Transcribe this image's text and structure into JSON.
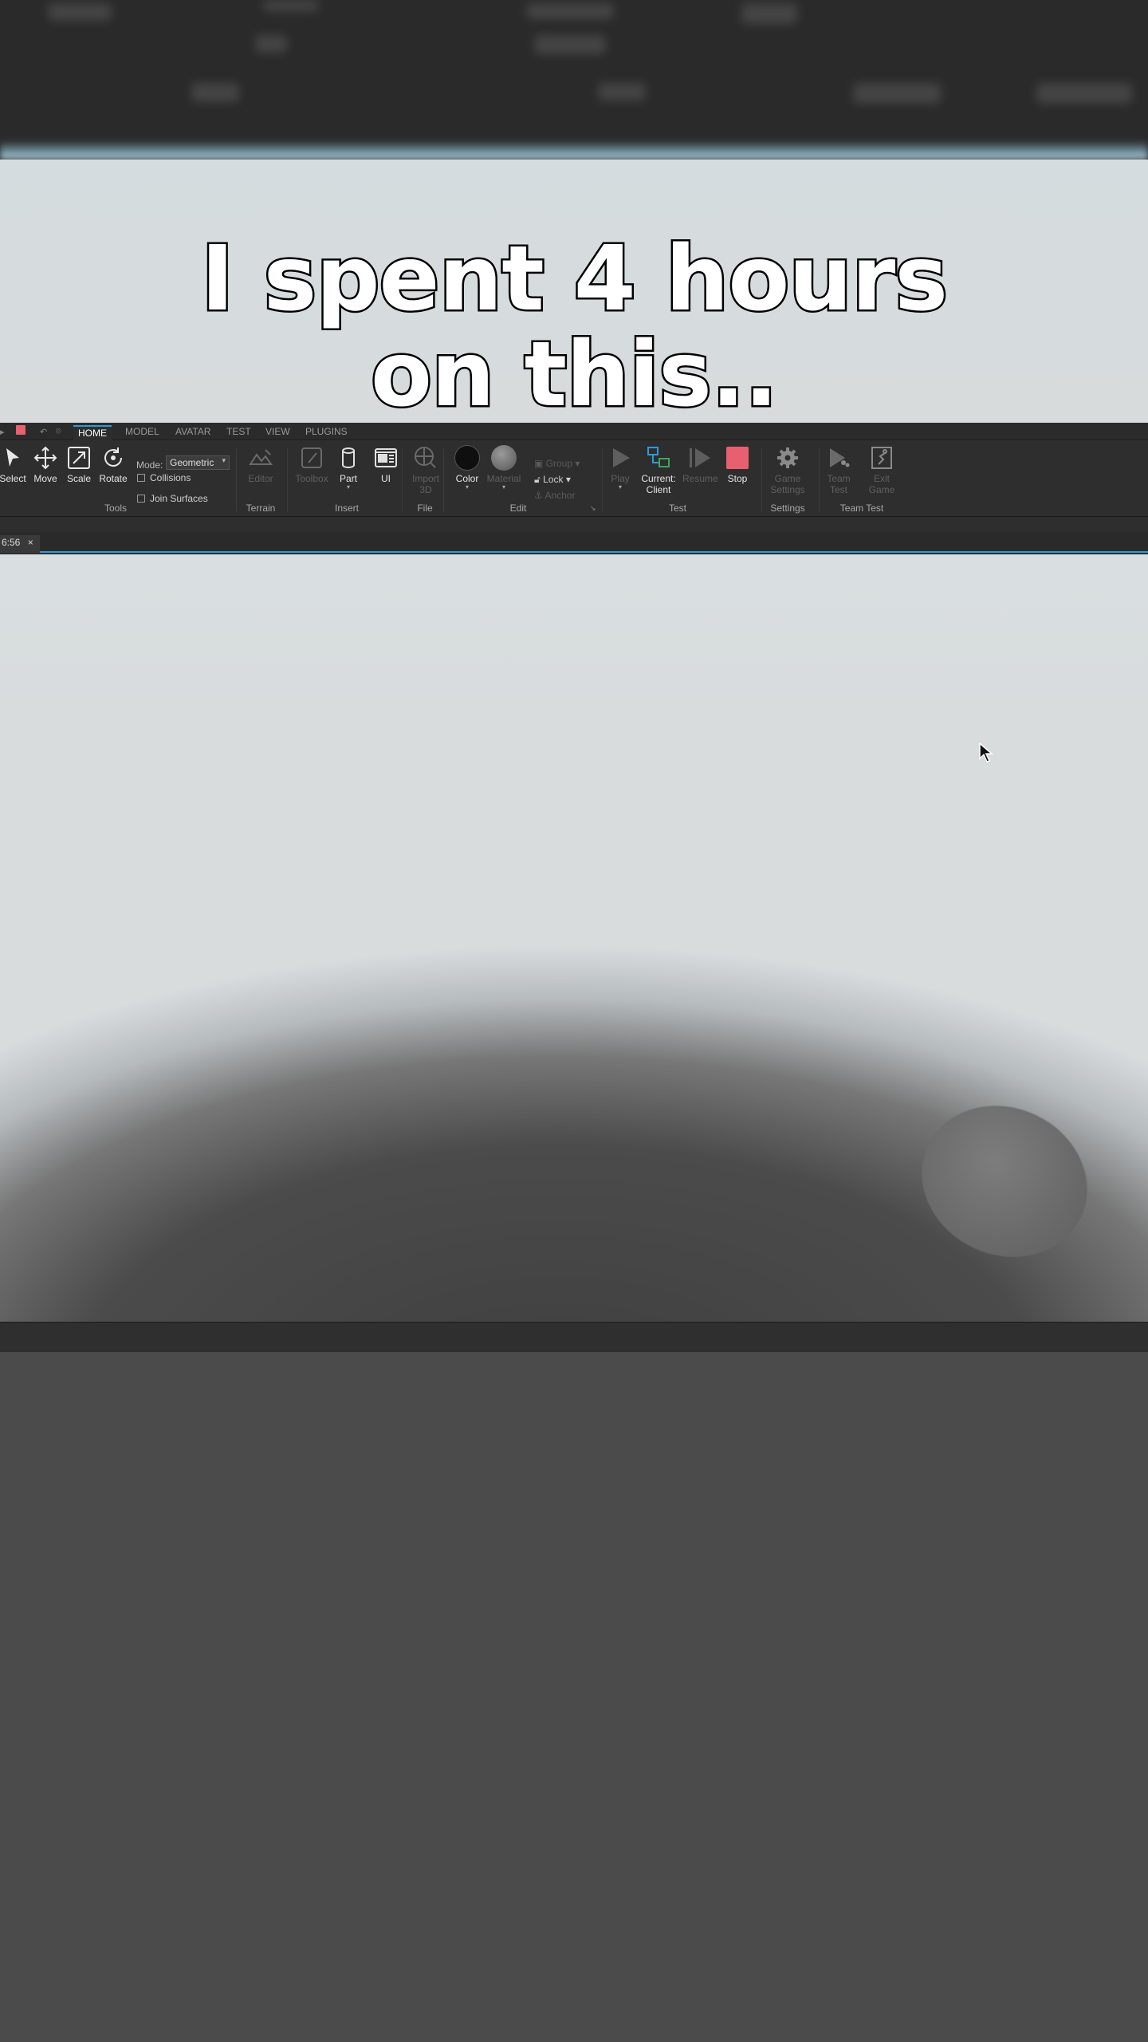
{
  "caption": {
    "line1": "I spent 4 hours",
    "line2": "on this.."
  },
  "menu_tabs": [
    "HOME",
    "MODEL",
    "AVATAR",
    "TEST",
    "VIEW",
    "PLUGINS"
  ],
  "active_tab": "HOME",
  "tools": {
    "select": "Select",
    "move": "Move",
    "scale": "Scale",
    "rotate": "Rotate",
    "mode_label": "Mode:",
    "mode_value": "Geometric",
    "collisions": "Collisions",
    "join_surfaces": "Join Surfaces",
    "group_label": "Tools"
  },
  "terrain": {
    "editor": "Editor",
    "group_label": "Terrain"
  },
  "insert": {
    "toolbox": "Toolbox",
    "part": "Part",
    "ui": "UI",
    "group_label": "Insert"
  },
  "file": {
    "import3d_line1": "Import",
    "import3d_line2": "3D",
    "group_label": "File"
  },
  "edit": {
    "color": "Color",
    "material": "Material",
    "group": "Group",
    "lock": "Lock",
    "anchor": "Anchor",
    "group_label": "Edit"
  },
  "test": {
    "play": "Play",
    "current_client_line1": "Current:",
    "current_client_line2": "Client",
    "resume": "Resume",
    "stop": "Stop",
    "group_label": "Test"
  },
  "settings": {
    "game_settings_line1": "Game",
    "game_settings_line2": "Settings",
    "group_label": "Settings"
  },
  "team_test": {
    "team_test_line1": "Team",
    "team_test_line2": "Test",
    "exit_game_line1": "Exit",
    "exit_game_line2": "Game",
    "group_label": "Team Test"
  },
  "document_tab": {
    "title": "6:56",
    "close": "×"
  },
  "colors": {
    "accent": "#2f9bd6",
    "stop": "#e8606f",
    "color_swatch": "#0f0f0f"
  },
  "icons": [
    "cursor-arrow-icon",
    "move-icon",
    "scale-icon",
    "rotate-icon",
    "terrain-editor-icon",
    "toolbox-icon",
    "part-icon",
    "ui-icon",
    "import-3d-icon",
    "color-icon",
    "material-icon",
    "group-icon",
    "lock-icon",
    "anchor-icon",
    "play-icon",
    "current-client-icon",
    "resume-icon",
    "stop-icon",
    "gear-icon",
    "team-test-icon",
    "exit-game-icon",
    "mouse-pointer-icon"
  ]
}
